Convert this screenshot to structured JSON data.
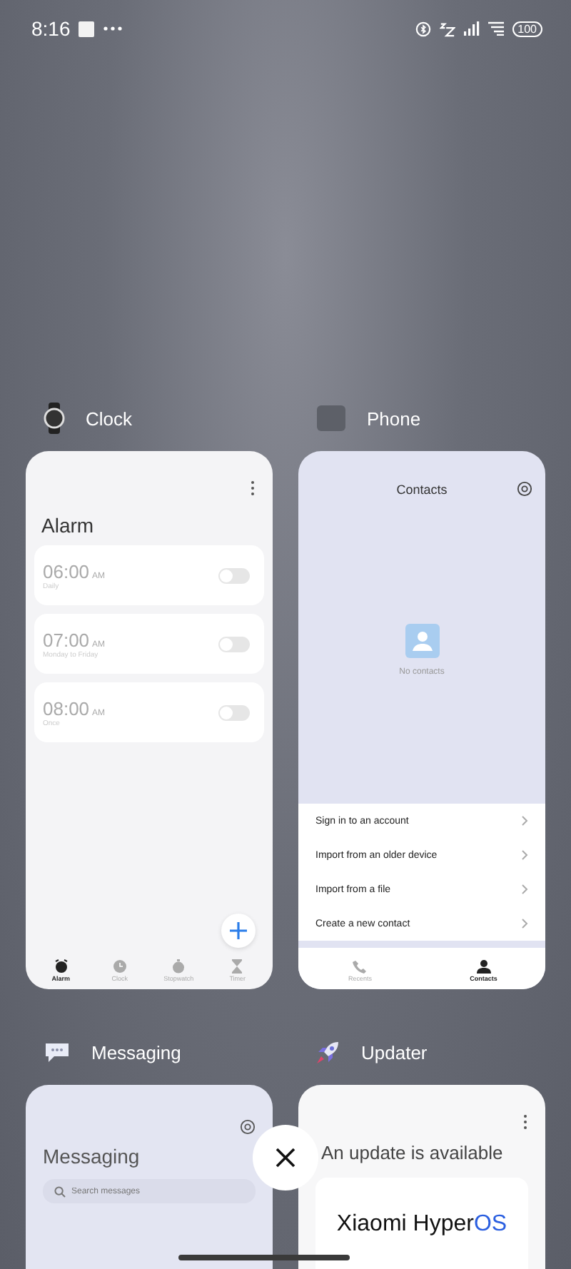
{
  "status_bar": {
    "time": "8:16",
    "battery": "100"
  },
  "clock": {
    "app": "Clock",
    "title": "Alarm",
    "alarms": [
      {
        "time": "06:00",
        "period": "AM",
        "repeat": "Daily",
        "on": false
      },
      {
        "time": "07:00",
        "period": "AM",
        "repeat": "Monday to Friday",
        "on": false
      },
      {
        "time": "08:00",
        "period": "AM",
        "repeat": "Once",
        "on": false
      }
    ],
    "tabs": [
      {
        "label": "Alarm",
        "kind": "alarm",
        "selected": true
      },
      {
        "label": "Clock",
        "kind": "clock",
        "selected": false
      },
      {
        "label": "Stopwatch",
        "kind": "stopwatch",
        "selected": false
      },
      {
        "label": "Timer",
        "kind": "timer",
        "selected": false
      }
    ]
  },
  "phone": {
    "app": "Phone",
    "title": "Contacts",
    "empty": "No contacts",
    "actions": [
      "Sign in to an account",
      "Import from an older device",
      "Import from a file",
      "Create a new contact"
    ],
    "tabs": [
      {
        "label": "Recents",
        "kind": "recents",
        "selected": false
      },
      {
        "label": "Contacts",
        "kind": "contacts",
        "selected": true
      }
    ]
  },
  "messaging": {
    "app": "Messaging",
    "title": "Messaging",
    "search_placeholder": "Search messages"
  },
  "updater": {
    "app": "Updater",
    "title": "An update is available",
    "brand": "Xiaomi Hyper",
    "brand_accent": "OS"
  }
}
